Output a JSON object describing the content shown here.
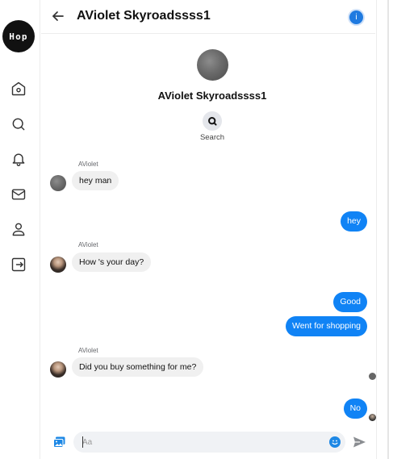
{
  "sidebar": {
    "logo_text": "Hop",
    "nav_icons": [
      "home-icon",
      "search-icon",
      "bell-icon",
      "mail-icon",
      "user-icon",
      "logout-icon"
    ]
  },
  "header": {
    "title": "AViolet Skyroadssss1",
    "back_icon": "arrow-left-icon",
    "info_icon": "info-icon",
    "info_glyph": "i"
  },
  "profile": {
    "name": "AViolet Skyroadssss1",
    "search_label": "Search"
  },
  "messages": [
    {
      "from": "them",
      "sender": "AViolet",
      "text": "hey man"
    },
    {
      "from": "me",
      "text": "hey"
    },
    {
      "from": "them",
      "sender": "AViolet",
      "text": "How 's your day?"
    },
    {
      "from": "me",
      "text": "Good"
    },
    {
      "from": "me",
      "text": "Went for shopping"
    },
    {
      "from": "them",
      "sender": "AViolet",
      "text": "Did you buy something for me?"
    },
    {
      "from": "me",
      "text": "No"
    }
  ],
  "composer": {
    "placeholder": "Aa",
    "photo_icon": "photo-icon",
    "emoji_icon": "emoji-icon",
    "send_icon": "send-icon"
  },
  "colors": {
    "accent": "#1083f5",
    "incoming_bubble": "#f0f0f0",
    "logo_bg": "#111111"
  }
}
